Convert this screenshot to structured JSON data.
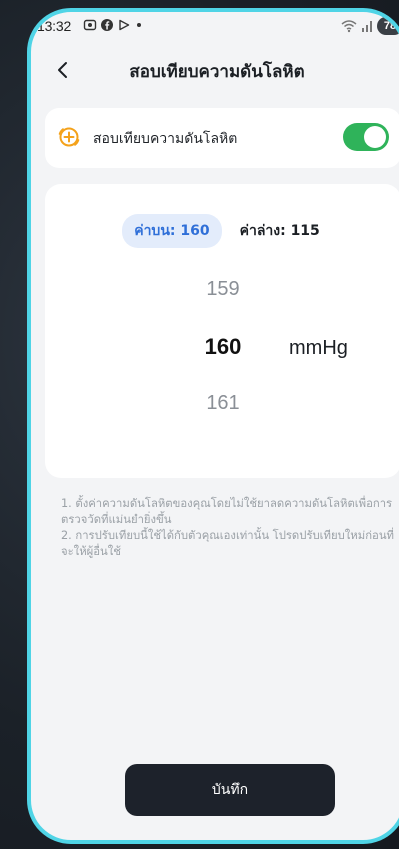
{
  "status_bar": {
    "time": "13:32",
    "battery": "78",
    "icons": [
      "camera-icon",
      "facebook-icon",
      "play-icon",
      "dot-icon",
      "wifi-icon",
      "signal-icon"
    ]
  },
  "header": {
    "title": "สอบเทียบความดันโลหิต",
    "back_icon": "chevron-left-icon"
  },
  "calibration_toggle": {
    "label": "สอบเทียบความดันโลหิต",
    "enabled": true,
    "icon": "plus-circle-icon",
    "accent_color": "#f4a21b",
    "switch_color": "#2fb35a"
  },
  "picker": {
    "upper_tab": "ค่าบน: 160",
    "lower_tab": "ค่าล่าง: 115",
    "prev_value": "159",
    "selected_value": "160",
    "next_value": "161",
    "unit": "mmHg",
    "active_color": "#2f6fd8"
  },
  "notes": {
    "line1": "1. ตั้งค่าความดันโลหิตของคุณโดยไม่ใช้ยาลดความดันโลหิตเพื่อการตรวจวัดที่แม่นยำยิ่งขึ้น",
    "line2": "2. การปรับเทียบนี้ใช้ได้กับตัวคุณเองเท่านั้น โปรดปรับเทียบใหม่ก่อนที่จะให้ผู้อื่นใช้"
  },
  "save_button": {
    "label": "บันทึก"
  }
}
